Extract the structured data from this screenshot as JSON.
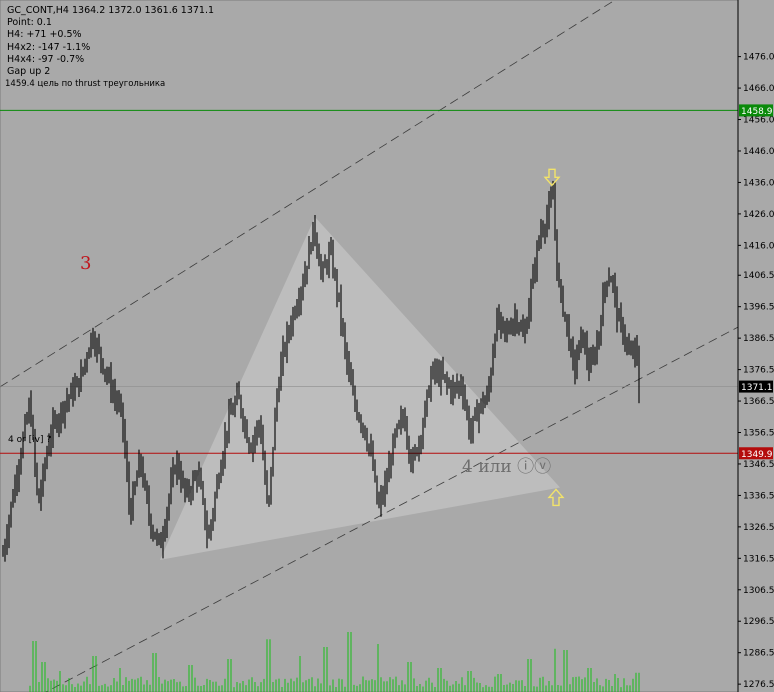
{
  "header": {
    "symbol_line": "GC_CONT,H4  1364.2 1372.0 1361.6 1371.1",
    "lines": [
      "Point: 0.1",
      "H4: +71 +0.5%",
      "H4x2: -147 -1.1%",
      "H4x4: -97 -0.7%",
      "Gap up 2"
    ]
  },
  "annotations": {
    "target_label": "1459.4 цель по thrust треугольника",
    "wave3": "3",
    "wave4": "4 или ⓘⓥ",
    "wave4_small": "4 or [iv] ?"
  },
  "colors": {
    "background": "#a9a9a9",
    "green_line": "#0a8a0a",
    "red_line": "#b40c0c",
    "candles": "#000000",
    "volume": "#18c018",
    "arrow": "#f2e36a",
    "triangle": "#c4c4c4"
  },
  "chart_data": {
    "type": "candlestick",
    "symbol": "GC_CONT",
    "timeframe": "H4",
    "last_bar": {
      "open": 1364.2,
      "high": 1372.0,
      "low": 1361.6,
      "close": 1371.1
    },
    "ylim": [
      1274,
      1494
    ],
    "y_ticks": [
      1476.0,
      1466.0,
      1456.0,
      1446.0,
      1436.0,
      1426.0,
      1416.0,
      1406.5,
      1396.5,
      1386.5,
      1376.5,
      1366.5,
      1356.5,
      1346.5,
      1336.5,
      1326.5,
      1316.5,
      1306.5,
      1296.5,
      1286.5,
      1276.5
    ],
    "levels": [
      {
        "name": "green",
        "price": 1458.9,
        "label": "1458.9"
      },
      {
        "name": "red",
        "price": 1349.9,
        "label": "1349.9"
      },
      {
        "name": "last",
        "price": 1371.1,
        "label": "1371.1"
      }
    ],
    "channel": {
      "upper": [
        [
          0,
          1371.0
        ],
        [
          620,
          1495.0
        ]
      ],
      "lower": [
        [
          40,
          1273.0
        ],
        [
          738,
          1390.0
        ]
      ]
    },
    "triangle": [
      [
        160,
        1316.0
      ],
      [
        315,
        1425.0
      ],
      [
        560,
        1339.0
      ]
    ],
    "arrows": [
      {
        "x": 552,
        "price": 1437.0,
        "direction": "down"
      },
      {
        "x": 556,
        "price": 1336.5,
        "direction": "up"
      }
    ],
    "pivots": [
      [
        3,
        1318
      ],
      [
        18,
        1346
      ],
      [
        30,
        1366
      ],
      [
        38,
        1333
      ],
      [
        50,
        1356
      ],
      [
        65,
        1366
      ],
      [
        80,
        1373
      ],
      [
        92,
        1388
      ],
      [
        100,
        1381
      ],
      [
        112,
        1370
      ],
      [
        122,
        1362
      ],
      [
        130,
        1330
      ],
      [
        140,
        1348
      ],
      [
        150,
        1328
      ],
      [
        160,
        1320
      ],
      [
        168,
        1334
      ],
      [
        176,
        1348
      ],
      [
        186,
        1336
      ],
      [
        198,
        1344
      ],
      [
        208,
        1322
      ],
      [
        218,
        1342
      ],
      [
        228,
        1360
      ],
      [
        238,
        1368
      ],
      [
        250,
        1352
      ],
      [
        260,
        1360
      ],
      [
        268,
        1330
      ],
      [
        276,
        1366
      ],
      [
        282,
        1380
      ],
      [
        292,
        1393
      ],
      [
        304,
        1406
      ],
      [
        314,
        1422
      ],
      [
        322,
        1406
      ],
      [
        330,
        1414
      ],
      [
        338,
        1400
      ],
      [
        346,
        1380
      ],
      [
        354,
        1366
      ],
      [
        364,
        1358
      ],
      [
        372,
        1348
      ],
      [
        378,
        1332
      ],
      [
        386,
        1340
      ],
      [
        394,
        1354
      ],
      [
        404,
        1362
      ],
      [
        412,
        1346
      ],
      [
        422,
        1358
      ],
      [
        432,
        1376
      ],
      [
        442,
        1374
      ],
      [
        452,
        1370
      ],
      [
        462,
        1372
      ],
      [
        470,
        1356
      ],
      [
        478,
        1364
      ],
      [
        488,
        1368
      ],
      [
        496,
        1392
      ],
      [
        506,
        1388
      ],
      [
        516,
        1394
      ],
      [
        524,
        1386
      ],
      [
        532,
        1404
      ],
      [
        540,
        1420
      ],
      [
        548,
        1426
      ],
      [
        553,
        1432
      ],
      [
        558,
        1404
      ],
      [
        566,
        1392
      ],
      [
        574,
        1376
      ],
      [
        582,
        1388
      ],
      [
        590,
        1376
      ],
      [
        598,
        1386
      ],
      [
        606,
        1406
      ],
      [
        612,
        1406
      ],
      [
        618,
        1392
      ],
      [
        624,
        1388
      ],
      [
        630,
        1380
      ],
      [
        636,
        1384
      ],
      [
        640,
        1364
      ]
    ],
    "volume_peaks": [
      [
        34,
        0.85
      ],
      [
        43,
        0.5
      ],
      [
        60,
        0.35
      ],
      [
        95,
        0.6
      ],
      [
        120,
        0.4
      ],
      [
        155,
        0.65
      ],
      [
        190,
        0.45
      ],
      [
        230,
        0.55
      ],
      [
        268,
        0.88
      ],
      [
        300,
        0.6
      ],
      [
        326,
        0.75
      ],
      [
        350,
        1.0
      ],
      [
        378,
        0.8
      ],
      [
        410,
        0.5
      ],
      [
        440,
        0.4
      ],
      [
        470,
        0.35
      ],
      [
        500,
        0.3
      ],
      [
        530,
        0.55
      ],
      [
        555,
        0.72
      ],
      [
        566,
        0.7
      ],
      [
        590,
        0.4
      ],
      [
        615,
        0.3
      ],
      [
        638,
        0.32
      ]
    ]
  }
}
